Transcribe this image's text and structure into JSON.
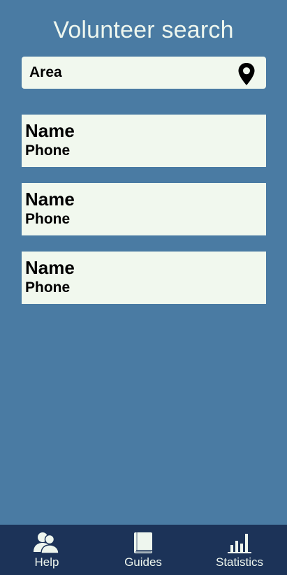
{
  "header": {
    "title": "Volunteer search"
  },
  "search": {
    "area_placeholder": "Area",
    "location_icon": "map-pin-icon"
  },
  "results": [
    {
      "name": "Name",
      "phone": "Phone"
    },
    {
      "name": "Name",
      "phone": "Phone"
    },
    {
      "name": "Name",
      "phone": "Phone"
    }
  ],
  "bottom_nav": {
    "items": [
      {
        "label": "Help",
        "icon": "people-icon"
      },
      {
        "label": "Guides",
        "icon": "book-icon"
      },
      {
        "label": "Statistics",
        "icon": "bar-chart-icon"
      }
    ]
  },
  "colors": {
    "background": "#4a7ba3",
    "card": "#f1f8ee",
    "nav_background": "#1c3358",
    "title_text": "#eef6ee"
  }
}
